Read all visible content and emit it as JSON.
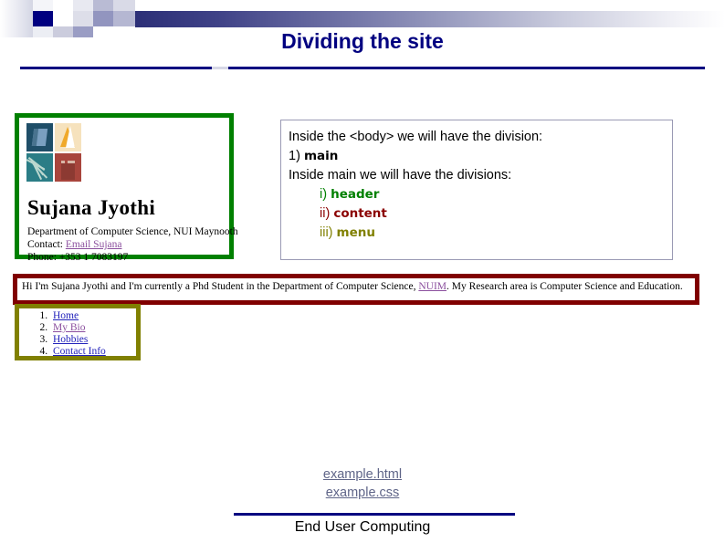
{
  "slide": {
    "title": "Dividing the site",
    "footer": "End User Computing"
  },
  "explanation": {
    "line1": "Inside the <body> we will have the division:",
    "item1_num": "1)",
    "item1_name": "main",
    "line2": "Inside main we will have the divisions:",
    "sub1_num": "i)",
    "sub1_name": "header",
    "sub2_num": "ii)",
    "sub2_name": "content",
    "sub3_num": "iii)",
    "sub3_name": "menu",
    "colors": {
      "header": "#008000",
      "content": "#8b0000",
      "menu": "#808000"
    }
  },
  "mock": {
    "header": {
      "border_color": "#008000",
      "name": "Sujana Jyothi",
      "department": "Department of Computer Science, NUI Maynooth",
      "contact_label": "Contact:",
      "contact_link": "Email Sujana",
      "phone": "Phone: +353 1 7083197",
      "logo_name": "nui-maynooth-crest"
    },
    "content": {
      "border_color": "#800000",
      "text_before": "Hi I'm Sujana Jyothi and I'm currently a Phd Student in the Department of Computer Science,",
      "link": "NUIM",
      "text_after": ". My Research area is Computer Science and Education."
    },
    "menu": {
      "border_color": "#808000",
      "items": [
        {
          "label": "Home",
          "visited": false
        },
        {
          "label": "My Bio",
          "visited": true
        },
        {
          "label": "Hobbies",
          "visited": false
        },
        {
          "label": "Contact Info",
          "visited": false
        }
      ]
    }
  },
  "files": [
    {
      "label": "example.html"
    },
    {
      "label": "example.css"
    }
  ]
}
